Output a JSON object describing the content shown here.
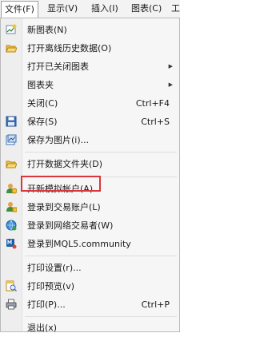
{
  "menubar": {
    "items": [
      {
        "label": "文件(F)"
      },
      {
        "label": "显示(V)"
      },
      {
        "label": "插入(I)"
      },
      {
        "label": "图表(C)"
      },
      {
        "label": "工"
      }
    ]
  },
  "menu": {
    "items": [
      {
        "label": "新图表(N)",
        "shortcut": "",
        "icon": "new-chart-icon"
      },
      {
        "label": "打开离线历史数据(O)",
        "shortcut": "",
        "icon": "open-folder-icon"
      },
      {
        "label": "打开已关闭图表",
        "shortcut": "",
        "icon": "",
        "submenu": true
      },
      {
        "label": "图表夹",
        "shortcut": "",
        "icon": "",
        "submenu": true
      },
      {
        "label": "关闭(C)",
        "shortcut": "Ctrl+F4",
        "icon": ""
      },
      {
        "label": "保存(S)",
        "shortcut": "Ctrl+S",
        "icon": "save-icon"
      },
      {
        "label": "保存为图片(i)...",
        "shortcut": "",
        "icon": "save-picture-icon"
      },
      {
        "label": "打开数据文件夹(D)",
        "shortcut": "",
        "icon": "data-folder-icon"
      },
      {
        "label": "开新模拟帐户(A)",
        "shortcut": "",
        "icon": "demo-account-icon"
      },
      {
        "label": "登录到交易账户(L)",
        "shortcut": "",
        "icon": "trade-login-icon"
      },
      {
        "label": "登录到网络交易者(W)",
        "shortcut": "",
        "icon": "web-trader-icon"
      },
      {
        "label": "登录到MQL5.community",
        "shortcut": "",
        "icon": "mql5-icon"
      },
      {
        "label": "打印设置(r)...",
        "shortcut": "",
        "icon": ""
      },
      {
        "label": "打印预览(v)",
        "shortcut": "",
        "icon": "print-preview-icon"
      },
      {
        "label": "打印(P)...",
        "shortcut": "Ctrl+P",
        "icon": "printer-icon"
      },
      {
        "label": "退出(x)",
        "shortcut": "",
        "icon": ""
      }
    ]
  },
  "colors": {
    "highlight_border": "#d9363e",
    "menu_bg": "#f6f6f6",
    "menubar_bg": "#f3f3f3"
  }
}
